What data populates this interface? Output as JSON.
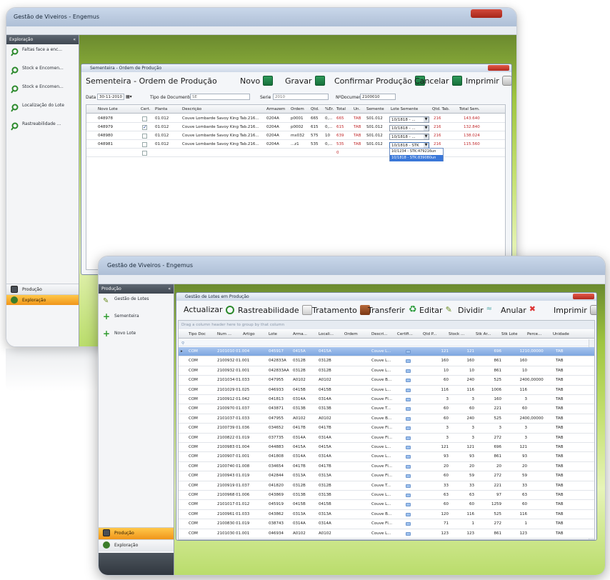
{
  "back_window": {
    "app_title": "Gestão de Viveiros - Engemus",
    "sidebar": {
      "header": "Exploração",
      "items": [
        {
          "label": "Faltas face a enc..."
        },
        {
          "label": "Stock e Encomen..."
        },
        {
          "label": "Stock e Encomen..."
        },
        {
          "label": "Localização do Lote"
        },
        {
          "label": "Rastreabilidade ..."
        }
      ],
      "bottom_buttons": [
        {
          "label": "Produção"
        },
        {
          "label": "Exploração"
        }
      ]
    },
    "child_window": {
      "title": "Sementeira - Ordem de Produção",
      "heading": "Sementeira - Ordem de Produção",
      "toolbar": {
        "novo": "Novo",
        "gravar": "Gravar",
        "confirmar": "Confirmar Produção",
        "cancelar": "Cancelar",
        "imprimir": "Imprimir"
      },
      "form": {
        "data_label": "Data",
        "data_value": "30-11-2010",
        "tipo_label": "Tipo de Documento",
        "tipo_value": "SE",
        "serie_label": "Serie",
        "serie_value": "2010",
        "ndoc_label": "NºDocumento",
        "ndoc_value": "2100010"
      },
      "columns": [
        "Novo Lote",
        "Cert.",
        "Planta",
        "Descrição",
        "Armazem",
        "Ordem",
        "Qtd.",
        "%Er.",
        "Total",
        "Un.",
        "Semente",
        "Lote Semente",
        "Qtd. Tab.",
        "Total Sem."
      ],
      "rows": [
        {
          "lote": "048978",
          "cert": false,
          "planta": "01.012",
          "desc": "Couve Lombarde Savoy King Tab.216...",
          "arm": "0204A",
          "ordem": "p0001",
          "qtd": "665",
          "er": "0,...",
          "total": "665",
          "un": "TAB",
          "sem": "S01.012",
          "lote_sem": "10/1818 - ...",
          "qtd_tab": "216",
          "total_sem": "143.640"
        },
        {
          "lote": "048979",
          "cert": true,
          "planta": "01.012",
          "desc": "Couve Lombarde Savoy King Tab.216...",
          "arm": "0204A",
          "ordem": "p0002",
          "qtd": "615",
          "er": "0,...",
          "total": "615",
          "un": "TAB",
          "sem": "S01.012",
          "lote_sem": "10/1818 - ...",
          "qtd_tab": "216",
          "total_sem": "132.840"
        },
        {
          "lote": "048980",
          "cert": false,
          "planta": "01.012",
          "desc": "Couve Lombarde Savoy King Tab.216...",
          "arm": "0204A",
          "ordem": "mx032",
          "qtd": "575",
          "er": "10",
          "total": "639",
          "un": "TAB",
          "sem": "S01.012",
          "lote_sem": "10/1818 - ...",
          "qtd_tab": "216",
          "total_sem": "138.024"
        },
        {
          "lote": "048981",
          "cert": false,
          "planta": "01.012",
          "desc": "Couve Lombarde Savoy King Tab.216...",
          "arm": "0204A",
          "ordem": "...z1",
          "qtd": "535",
          "er": "0,...",
          "total": "535",
          "un": "TAB",
          "sem": "S01.012",
          "lote_sem": "10/1818 - STK",
          "qtd_tab": "216",
          "total_sem": "115.560"
        }
      ],
      "new_row_total": "0",
      "dropdown_options": [
        "10/1234 - STK:479216un",
        "10/1818 - STK:839080un"
      ]
    }
  },
  "front_window": {
    "app_title": "Gestão de Viveiros - Engemus",
    "sidebar": {
      "header": "Produção",
      "items": [
        {
          "label": "Gestão de Lotes"
        },
        {
          "label": "Sementeira"
        },
        {
          "label": "Novo Lote"
        }
      ],
      "bottom_buttons": [
        {
          "label": "Produção"
        },
        {
          "label": "Exploração"
        }
      ]
    },
    "child_window": {
      "title": "Gestão de Lotes em Produção",
      "toolbar": {
        "actualizar": "Actualizar",
        "rastreabilidade": "Rastreabilidade",
        "tratamento": "Tratamento",
        "transferir": "Transferir",
        "editar": "Editar",
        "dividir": "Dividir",
        "anular": "Anular",
        "imprimir": "Imprimir"
      },
      "group_hint": "Drag a column header here to group by that column",
      "columns": [
        "Tipo Doc",
        "Num ...",
        "Artigo",
        "Lote",
        "Arma...",
        "Locali...",
        "Ordem",
        "Descri...",
        "Certifi...",
        "Qtd P...",
        "Stock ...",
        "Stk Ar...",
        "Stk Lote",
        "Perce...",
        "Unidade"
      ],
      "rows": [
        {
          "tipo": "COM",
          "num": "2101010",
          "art": "01.004",
          "lote": "045917",
          "arm": "0415A",
          "loc": "0415A",
          "ordem": "",
          "desc": "Couve L...",
          "qtd": "121",
          "stock": "121",
          "stkar": "696",
          "stklote": "121",
          "perc": "0,00000",
          "un": "TAB"
        },
        {
          "tipo": "COM",
          "num": "2100932",
          "art": "01.001",
          "lote": "042833A",
          "arm": "0312B",
          "loc": "0312B",
          "ordem": "",
          "desc": "Couve L...",
          "qtd": "160",
          "stock": "160",
          "stkar": "861",
          "stklote": "160",
          "perc": "",
          "un": "TAB"
        },
        {
          "tipo": "COM",
          "num": "2100932",
          "art": "01.001",
          "lote": "042833AA",
          "arm": "0312B",
          "loc": "0312B",
          "ordem": "",
          "desc": "Couve L...",
          "qtd": "10",
          "stock": "10",
          "stkar": "861",
          "stklote": "10",
          "perc": "",
          "un": "TAB"
        },
        {
          "tipo": "COM",
          "num": "2101034",
          "art": "01.033",
          "lote": "047955",
          "arm": "A0102",
          "loc": "A0102",
          "ordem": "",
          "desc": "Couve B...",
          "qtd": "60",
          "stock": "240",
          "stkar": "525",
          "stklote": "240",
          "perc": "0,00000",
          "un": "TAB"
        },
        {
          "tipo": "COM",
          "num": "2101029",
          "art": "01.025",
          "lote": "046933",
          "arm": "0415B",
          "loc": "0415B",
          "ordem": "",
          "desc": "Couve L...",
          "qtd": "116",
          "stock": "116",
          "stkar": "1006",
          "stklote": "116",
          "perc": "",
          "un": "TAB"
        },
        {
          "tipo": "COM",
          "num": "2100912",
          "art": "01.042",
          "lote": "041813",
          "arm": "0314A",
          "loc": "0314A",
          "ordem": "",
          "desc": "Couve Fl...",
          "qtd": "3",
          "stock": "3",
          "stkar": "160",
          "stklote": "3",
          "perc": "",
          "un": "TAB"
        },
        {
          "tipo": "COM",
          "num": "2100970",
          "art": "01.037",
          "lote": "043871",
          "arm": "0313B",
          "loc": "0313B",
          "ordem": "",
          "desc": "Couve T...",
          "qtd": "60",
          "stock": "60",
          "stkar": "221",
          "stklote": "60",
          "perc": "",
          "un": "TAB"
        },
        {
          "tipo": "COM",
          "num": "2101037",
          "art": "01.033",
          "lote": "047955",
          "arm": "A0102",
          "loc": "A0102",
          "ordem": "",
          "desc": "Couve B...",
          "qtd": "60",
          "stock": "240",
          "stkar": "525",
          "stklote": "240",
          "perc": "0,00000",
          "un": "TAB"
        },
        {
          "tipo": "COM",
          "num": "2100739",
          "art": "01.036",
          "lote": "034652",
          "arm": "0417B",
          "loc": "0417B",
          "ordem": "",
          "desc": "Couve Fl...",
          "qtd": "3",
          "stock": "3",
          "stkar": "3",
          "stklote": "3",
          "perc": "",
          "un": "TAB"
        },
        {
          "tipo": "COM",
          "num": "2100822",
          "art": "01.019",
          "lote": "037735",
          "arm": "0314A",
          "loc": "0314A",
          "ordem": "",
          "desc": "Couve Fl...",
          "qtd": "3",
          "stock": "3",
          "stkar": "272",
          "stklote": "3",
          "perc": "",
          "un": "TAB"
        },
        {
          "tipo": "COM",
          "num": "2100983",
          "art": "01.004",
          "lote": "044883",
          "arm": "0415A",
          "loc": "0415A",
          "ordem": "",
          "desc": "Couve L...",
          "qtd": "121",
          "stock": "121",
          "stkar": "696",
          "stklote": "121",
          "perc": "",
          "un": "TAB"
        },
        {
          "tipo": "COM",
          "num": "2100907",
          "art": "01.001",
          "lote": "041808",
          "arm": "0314A",
          "loc": "0314A",
          "ordem": "",
          "desc": "Couve L...",
          "qtd": "93",
          "stock": "93",
          "stkar": "861",
          "stklote": "93",
          "perc": "",
          "un": "TAB"
        },
        {
          "tipo": "COM",
          "num": "2100740",
          "art": "01.008",
          "lote": "034654",
          "arm": "0417B",
          "loc": "0417B",
          "ordem": "",
          "desc": "Couve Fl...",
          "qtd": "20",
          "stock": "20",
          "stkar": "20",
          "stklote": "20",
          "perc": "",
          "un": "TAB"
        },
        {
          "tipo": "COM",
          "num": "2100943",
          "art": "01.019",
          "lote": "042844",
          "arm": "0313A",
          "loc": "0313A",
          "ordem": "",
          "desc": "Couve Fl...",
          "qtd": "60",
          "stock": "59",
          "stkar": "272",
          "stklote": "59",
          "perc": "",
          "un": "TAB"
        },
        {
          "tipo": "COM",
          "num": "2100919",
          "art": "01.037",
          "lote": "041820",
          "arm": "0312B",
          "loc": "0312B",
          "ordem": "",
          "desc": "Couve T...",
          "qtd": "33",
          "stock": "33",
          "stkar": "221",
          "stklote": "33",
          "perc": "",
          "un": "TAB"
        },
        {
          "tipo": "COM",
          "num": "2100968",
          "art": "01.006",
          "lote": "043869",
          "arm": "0313B",
          "loc": "0313B",
          "ordem": "",
          "desc": "Couve L...",
          "qtd": "63",
          "stock": "63",
          "stkar": "97",
          "stklote": "63",
          "perc": "",
          "un": "TAB"
        },
        {
          "tipo": "COM",
          "num": "2101017",
          "art": "01.012",
          "lote": "045919",
          "arm": "0415B",
          "loc": "0415B",
          "ordem": "",
          "desc": "Couve L...",
          "qtd": "60",
          "stock": "60",
          "stkar": "1259",
          "stklote": "60",
          "perc": "",
          "un": "TAB"
        },
        {
          "tipo": "COM",
          "num": "2100961",
          "art": "01.033",
          "lote": "043862",
          "arm": "0313A",
          "loc": "0313A",
          "ordem": "",
          "desc": "Couve B...",
          "qtd": "120",
          "stock": "116",
          "stkar": "525",
          "stklote": "116",
          "perc": "",
          "un": "TAB"
        },
        {
          "tipo": "COM",
          "num": "2100830",
          "art": "01.019",
          "lote": "038743",
          "arm": "0314A",
          "loc": "0314A",
          "ordem": "",
          "desc": "Couve Fl...",
          "qtd": "71",
          "stock": "1",
          "stkar": "272",
          "stklote": "1",
          "perc": "",
          "un": "TAB"
        },
        {
          "tipo": "COM",
          "num": "2101030",
          "art": "01.001",
          "lote": "046934",
          "arm": "A0102",
          "loc": "A0102",
          "ordem": "",
          "desc": "Couve L...",
          "qtd": "123",
          "stock": "123",
          "stkar": "861",
          "stklote": "123",
          "perc": "",
          "un": "TAB"
        }
      ]
    }
  },
  "colors": {
    "accent_orange": "#f0951a",
    "selected_row": "#7da6e0",
    "red_values": "#c0282b",
    "sidebar_header": "#4a525c"
  }
}
